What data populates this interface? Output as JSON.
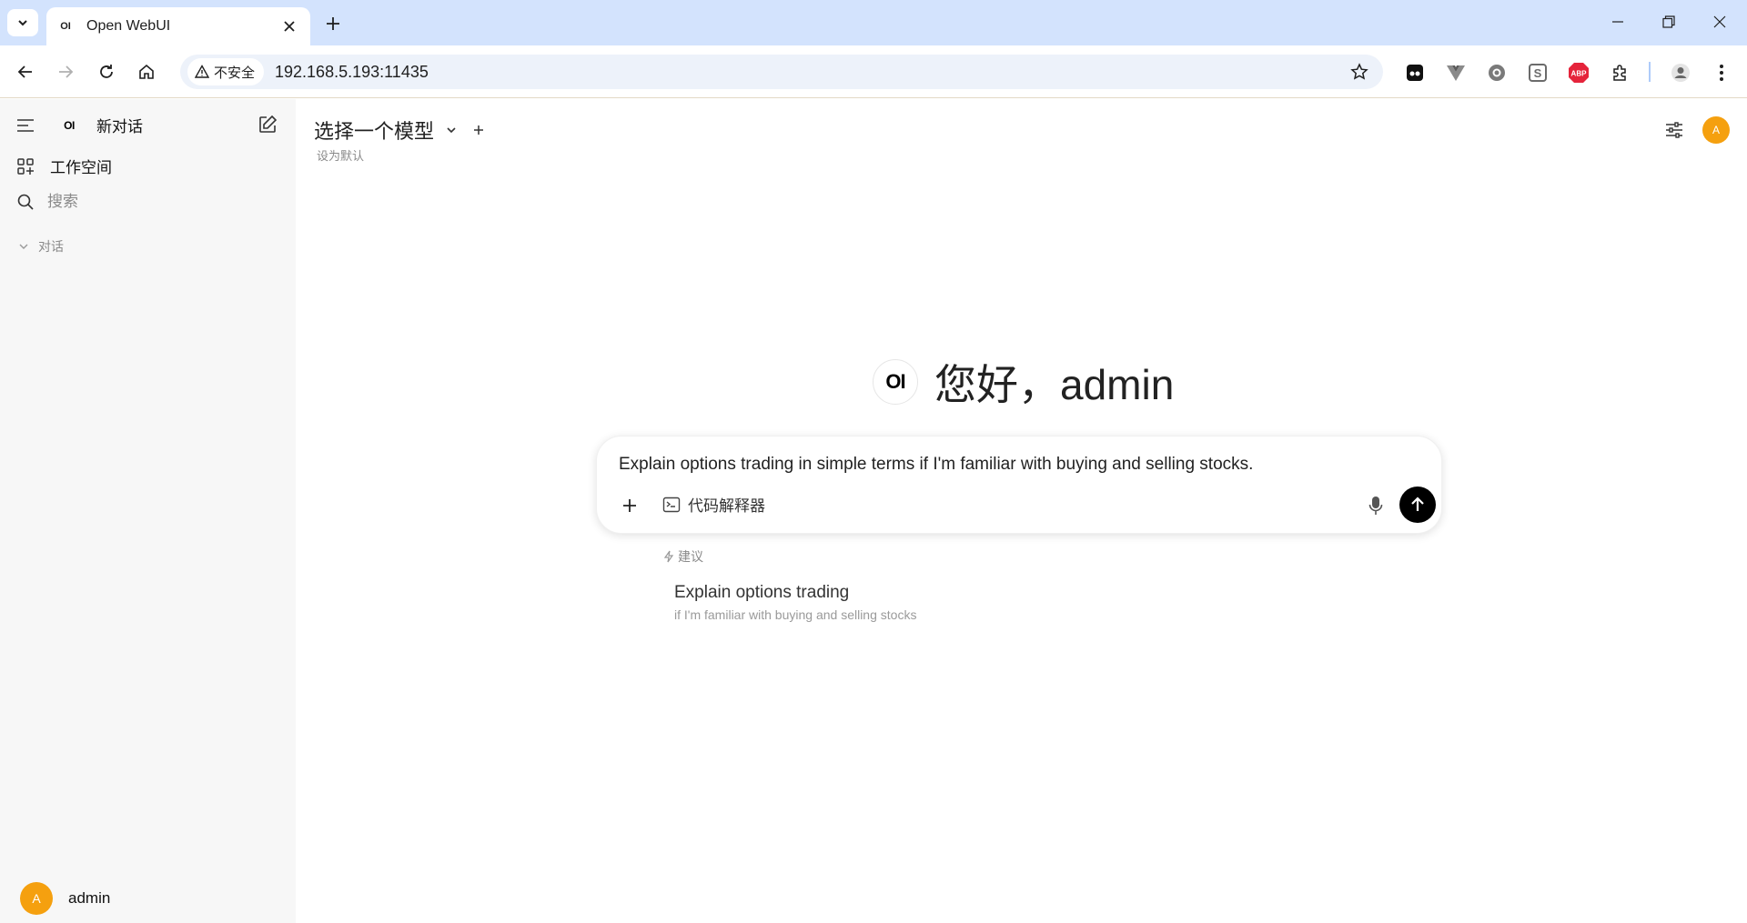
{
  "browser": {
    "tab_title": "Open WebUI",
    "tab_favicon": "OI",
    "security_label": "不安全",
    "url": "192.168.5.193:11435"
  },
  "sidebar": {
    "logo_text": "OI",
    "new_chat_label": "新对话",
    "workspace_label": "工作空间",
    "search_placeholder": "搜索",
    "section_label": "对话",
    "user_name": "admin",
    "user_initial": "A"
  },
  "header": {
    "model_select_label": "选择一个模型",
    "set_default_label": "设为默认",
    "avatar_initial": "A"
  },
  "greeting": {
    "logo_text": "OI",
    "text": "您好，admin"
  },
  "composer": {
    "prompt_text": "Explain options trading in simple terms if I'm familiar with buying and selling stocks.",
    "code_interpreter_label": "代码解释器"
  },
  "suggestions": {
    "header": "建议",
    "items": [
      {
        "title": "Explain options trading",
        "subtitle": "if I'm familiar with buying and selling stocks"
      }
    ]
  },
  "colors": {
    "tabstrip": "#d3e3fd",
    "avatar": "#f5a00f",
    "abp_badge": "#e5243b",
    "send_button": "#000000"
  }
}
